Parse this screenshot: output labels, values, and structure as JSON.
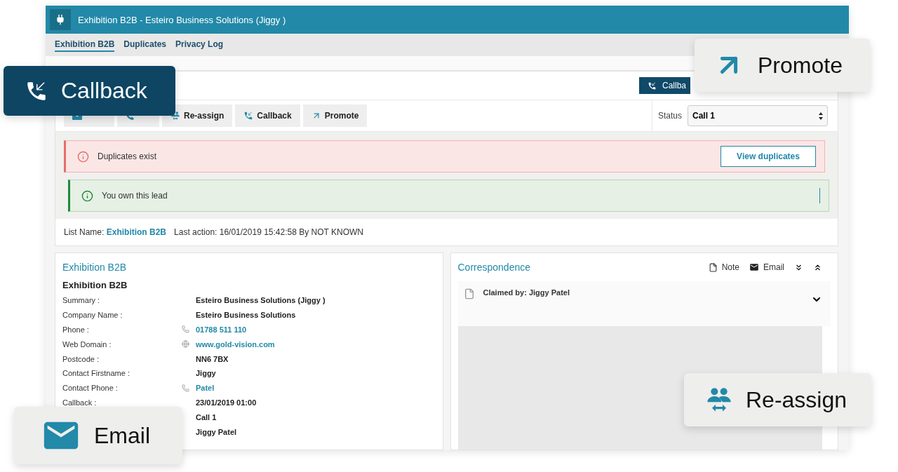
{
  "window": {
    "title": "Exhibition B2B - Esteiro Business Solutions (Jiggy )"
  },
  "tabs": [
    {
      "label": "Exhibition B2B",
      "selected": true
    },
    {
      "label": "Duplicates",
      "selected": false
    },
    {
      "label": "Privacy Log",
      "selected": false
    }
  ],
  "header_button": {
    "label": "Callba"
  },
  "toolbar": [
    {
      "kind": "email"
    },
    {
      "kind": "call"
    },
    {
      "kind": "reassign",
      "label": "Re-assign"
    },
    {
      "kind": "callback",
      "label": "Callback"
    },
    {
      "kind": "promote",
      "label": "Promote"
    }
  ],
  "status": {
    "label": "Status",
    "value": "Call 1"
  },
  "alerts": [
    {
      "kind": "error",
      "text": "Duplicates exist",
      "button": "View duplicates"
    },
    {
      "kind": "success",
      "text": "You own this lead"
    }
  ],
  "info": {
    "list_label": "List Name:",
    "list_name": "Exhibition B2B",
    "last_action": "Last action: 16/01/2019 15:42:58 By NOT KNOWN"
  },
  "details": {
    "title": "Exhibition B2B",
    "subtitle": "Exhibition B2B",
    "rows": [
      {
        "label": "Summary :",
        "value": "Esteiro Business Solutions (Jiggy )",
        "kind": "text"
      },
      {
        "label": "Company Name :",
        "value": "Esteiro Business Solutions",
        "kind": "text"
      },
      {
        "label": "Phone :",
        "value": "01788 511 110",
        "kind": "phone"
      },
      {
        "label": "Web Domain :",
        "value": "www.gold-vision.com",
        "kind": "web"
      },
      {
        "label": "Postcode :",
        "value": "NN6 7BX",
        "kind": "text"
      },
      {
        "label": "Contact Firstname :",
        "value": "Jiggy",
        "kind": "text"
      },
      {
        "label": "Contact Phone :",
        "value": "Patel",
        "kind": "phone"
      },
      {
        "label": "Callback :",
        "value": "23/01/2019 01:00",
        "kind": "text"
      },
      {
        "value": "Call 1",
        "kind": "text"
      },
      {
        "value": "Jiggy Patel",
        "kind": "text"
      }
    ]
  },
  "correspondence": {
    "title": "Correspondence",
    "actions": [
      {
        "kind": "note",
        "label": "Note"
      },
      {
        "kind": "email",
        "label": "Email"
      },
      {
        "kind": "expand"
      },
      {
        "kind": "collapse"
      }
    ],
    "item": {
      "text": "Claimed by: Jiggy Patel",
      "expanded": false
    }
  },
  "callouts": [
    {
      "kind": "callback",
      "label": "Callback"
    },
    {
      "kind": "promote",
      "label": "Promote"
    },
    {
      "kind": "reassign",
      "label": "Re-assign"
    },
    {
      "kind": "email",
      "label": "Email"
    }
  ]
}
